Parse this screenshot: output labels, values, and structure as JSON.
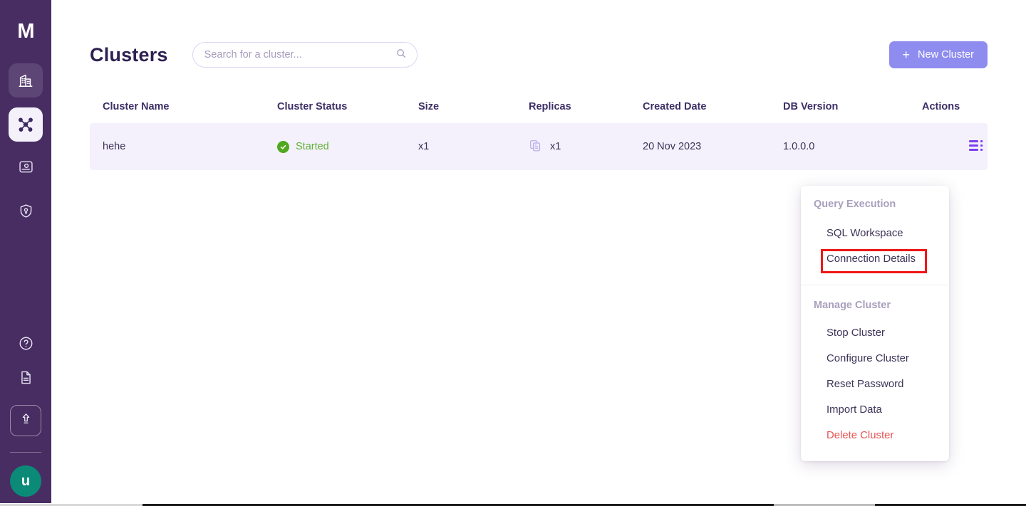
{
  "sidebar": {
    "logo": "M",
    "items": [
      {
        "name": "organization",
        "icon": "building-icon",
        "state": "dim"
      },
      {
        "name": "clusters",
        "icon": "cluster-nodes-icon",
        "state": "active"
      },
      {
        "name": "users",
        "icon": "id-card-icon",
        "state": "plain"
      },
      {
        "name": "security",
        "icon": "shield-key-icon",
        "state": "plain"
      }
    ],
    "bottom_items": [
      {
        "name": "help",
        "icon": "help-circle-icon"
      },
      {
        "name": "docs",
        "icon": "document-icon"
      },
      {
        "name": "upgrade",
        "icon": "upload-arrow-icon"
      }
    ],
    "avatar_initial": "u",
    "avatar_color": "#0b8a78",
    "background_color": "#472d62"
  },
  "header": {
    "title": "Clusters",
    "search": {
      "placeholder": "Search for a cluster...",
      "value": "",
      "icon": "search-icon"
    },
    "new_cluster_button": {
      "label": "New Cluster",
      "plus": "+",
      "color": "#8f8cf0"
    }
  },
  "table": {
    "columns": [
      "Cluster Name",
      "Cluster Status",
      "Size",
      "Replicas",
      "Created Date",
      "DB Version",
      "Actions"
    ],
    "rows": [
      {
        "name": "hehe",
        "status": "Started",
        "status_color": "#5fb136",
        "status_icon": "check-circle-icon",
        "size": "x1",
        "replicas": "x1",
        "replicas_icon": "copies-icon",
        "created_date": "20 Nov 2023",
        "db_version": "1.0.0.0",
        "actions_icon": "list-menu-icon",
        "row_background": "#f4f1fc"
      }
    ]
  },
  "context_menu": {
    "sections": [
      {
        "title": "Query Execution",
        "items": [
          {
            "label": "SQL Workspace",
            "danger": false
          },
          {
            "label": "Connection Details",
            "danger": false,
            "highlighted": true
          }
        ]
      },
      {
        "title": "Manage Cluster",
        "items": [
          {
            "label": "Stop Cluster",
            "danger": false
          },
          {
            "label": "Configure Cluster",
            "danger": false
          },
          {
            "label": "Reset Password",
            "danger": false
          },
          {
            "label": "Import Data",
            "danger": false
          },
          {
            "label": "Delete Cluster",
            "danger": true
          }
        ]
      }
    ],
    "highlight_color": "#f01616",
    "danger_color": "#ea5252"
  }
}
